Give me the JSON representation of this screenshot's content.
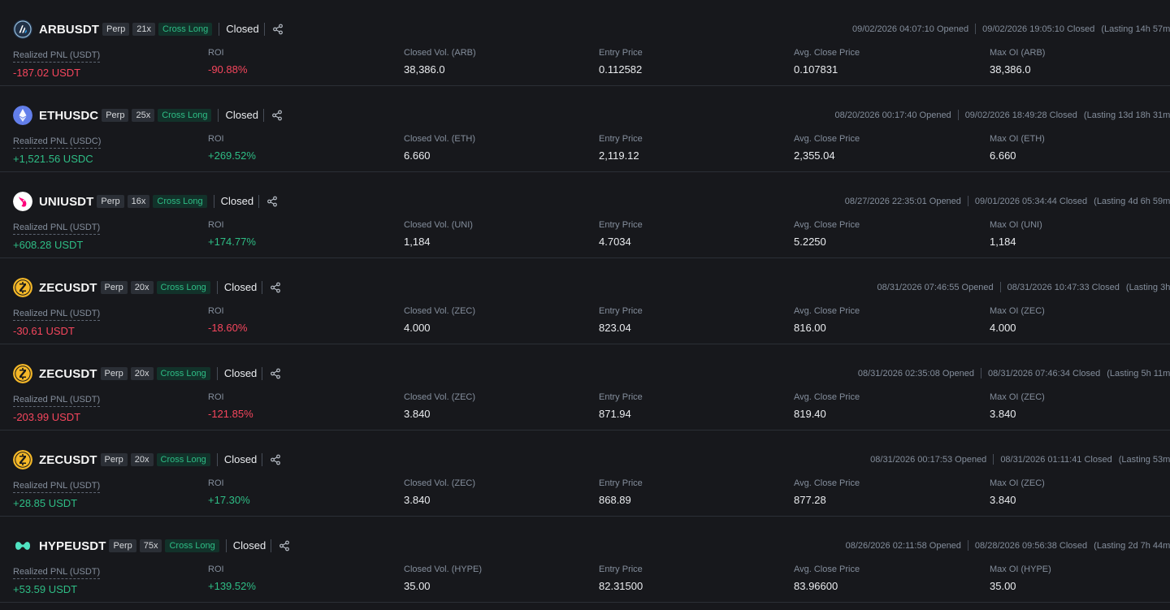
{
  "colors": {
    "background": "#17181c",
    "profit": "#2ebd85",
    "loss": "#f6465d",
    "muted": "#848e9c",
    "tag_bg": "#2b2f36"
  },
  "positions": [
    {
      "symbol": "ARBUSDT",
      "type_tag": "Perp",
      "leverage": "21x",
      "side": "Cross Long",
      "status": "Closed",
      "icon": "arb-icon",
      "icon_color": "#213147",
      "opened": "09/02/2026 04:07:10 Opened",
      "closed": "09/02/2026 19:05:10 Closed",
      "lasting": "(Lasting 14h 57m)",
      "pnl_label": "Realized PNL (USDT)",
      "pnl": "-187.02 USDT",
      "roi_label": "ROI",
      "roi": "-90.88%",
      "vol_label": "Closed Vol. (ARB)",
      "vol": "38,386.0",
      "entry_label": "Entry Price",
      "entry": "0.112582",
      "avg_close_label": "Avg. Close Price",
      "avg_close": "0.107831",
      "max_oi_label": "Max OI (ARB)",
      "max_oi": "38,386.0",
      "direction": "down"
    },
    {
      "symbol": "ETHUSDC",
      "type_tag": "Perp",
      "leverage": "25x",
      "side": "Cross Long",
      "status": "Closed",
      "icon": "eth-icon",
      "icon_color": "#627eea",
      "opened": "08/20/2026 00:17:40 Opened",
      "closed": "09/02/2026 18:49:28 Closed",
      "lasting": "(Lasting 13d 18h 31m)",
      "pnl_label": "Realized PNL (USDC)",
      "pnl": "+1,521.56 USDC",
      "roi_label": "ROI",
      "roi": "+269.52%",
      "vol_label": "Closed Vol. (ETH)",
      "vol": "6.660",
      "entry_label": "Entry Price",
      "entry": "2,119.12",
      "avg_close_label": "Avg. Close Price",
      "avg_close": "2,355.04",
      "max_oi_label": "Max OI (ETH)",
      "max_oi": "6.660",
      "direction": "up"
    },
    {
      "symbol": "UNIUSDT",
      "type_tag": "Perp",
      "leverage": "16x",
      "side": "Cross Long",
      "status": "Closed",
      "icon": "uni-icon",
      "icon_color": "#ffffff",
      "opened": "08/27/2026 22:35:01 Opened",
      "closed": "09/01/2026 05:34:44 Closed",
      "lasting": "(Lasting 4d 6h 59m)",
      "pnl_label": "Realized PNL (USDT)",
      "pnl": "+608.28 USDT",
      "roi_label": "ROI",
      "roi": "+174.77%",
      "vol_label": "Closed Vol. (UNI)",
      "vol": "1,184",
      "entry_label": "Entry Price",
      "entry": "4.7034",
      "avg_close_label": "Avg. Close Price",
      "avg_close": "5.2250",
      "max_oi_label": "Max OI (UNI)",
      "max_oi": "1,184",
      "direction": "up"
    },
    {
      "symbol": "ZECUSDT",
      "type_tag": "Perp",
      "leverage": "20x",
      "side": "Cross Long",
      "status": "Closed",
      "icon": "zec-icon",
      "icon_color": "#f4b728",
      "opened": "08/31/2026 07:46:55 Opened",
      "closed": "08/31/2026 10:47:33 Closed",
      "lasting": "(Lasting 3h)",
      "pnl_label": "Realized PNL (USDT)",
      "pnl": "-30.61 USDT",
      "roi_label": "ROI",
      "roi": "-18.60%",
      "vol_label": "Closed Vol. (ZEC)",
      "vol": "4.000",
      "entry_label": "Entry Price",
      "entry": "823.04",
      "avg_close_label": "Avg. Close Price",
      "avg_close": "816.00",
      "max_oi_label": "Max OI (ZEC)",
      "max_oi": "4.000",
      "direction": "down"
    },
    {
      "symbol": "ZECUSDT",
      "type_tag": "Perp",
      "leverage": "20x",
      "side": "Cross Long",
      "status": "Closed",
      "icon": "zec-icon",
      "icon_color": "#f4b728",
      "opened": "08/31/2026 02:35:08 Opened",
      "closed": "08/31/2026 07:46:34 Closed",
      "lasting": "(Lasting 5h 11m)",
      "pnl_label": "Realized PNL (USDT)",
      "pnl": "-203.99 USDT",
      "roi_label": "ROI",
      "roi": "-121.85%",
      "vol_label": "Closed Vol. (ZEC)",
      "vol": "3.840",
      "entry_label": "Entry Price",
      "entry": "871.94",
      "avg_close_label": "Avg. Close Price",
      "avg_close": "819.40",
      "max_oi_label": "Max OI (ZEC)",
      "max_oi": "3.840",
      "direction": "down"
    },
    {
      "symbol": "ZECUSDT",
      "type_tag": "Perp",
      "leverage": "20x",
      "side": "Cross Long",
      "status": "Closed",
      "icon": "zec-icon",
      "icon_color": "#f4b728",
      "opened": "08/31/2026 00:17:53 Opened",
      "closed": "08/31/2026 01:11:41 Closed",
      "lasting": "(Lasting 53m)",
      "pnl_label": "Realized PNL (USDT)",
      "pnl": "+28.85 USDT",
      "roi_label": "ROI",
      "roi": "+17.30%",
      "vol_label": "Closed Vol. (ZEC)",
      "vol": "3.840",
      "entry_label": "Entry Price",
      "entry": "868.89",
      "avg_close_label": "Avg. Close Price",
      "avg_close": "877.28",
      "max_oi_label": "Max OI (ZEC)",
      "max_oi": "3.840",
      "direction": "up"
    },
    {
      "symbol": "HYPEUSDT",
      "type_tag": "Perp",
      "leverage": "75x",
      "side": "Cross Long",
      "status": "Closed",
      "icon": "hype-icon",
      "icon_color": "#50e3c2",
      "opened": "08/26/2026 02:11:58 Opened",
      "closed": "08/28/2026 09:56:38 Closed",
      "lasting": "(Lasting 2d 7h 44m)",
      "pnl_label": "Realized PNL (USDT)",
      "pnl": "+53.59 USDT",
      "roi_label": "ROI",
      "roi": "+139.52%",
      "vol_label": "Closed Vol. (HYPE)",
      "vol": "35.00",
      "entry_label": "Entry Price",
      "entry": "82.31500",
      "avg_close_label": "Avg. Close Price",
      "avg_close": "83.96600",
      "max_oi_label": "Max OI (HYPE)",
      "max_oi": "35.00",
      "direction": "up"
    }
  ]
}
